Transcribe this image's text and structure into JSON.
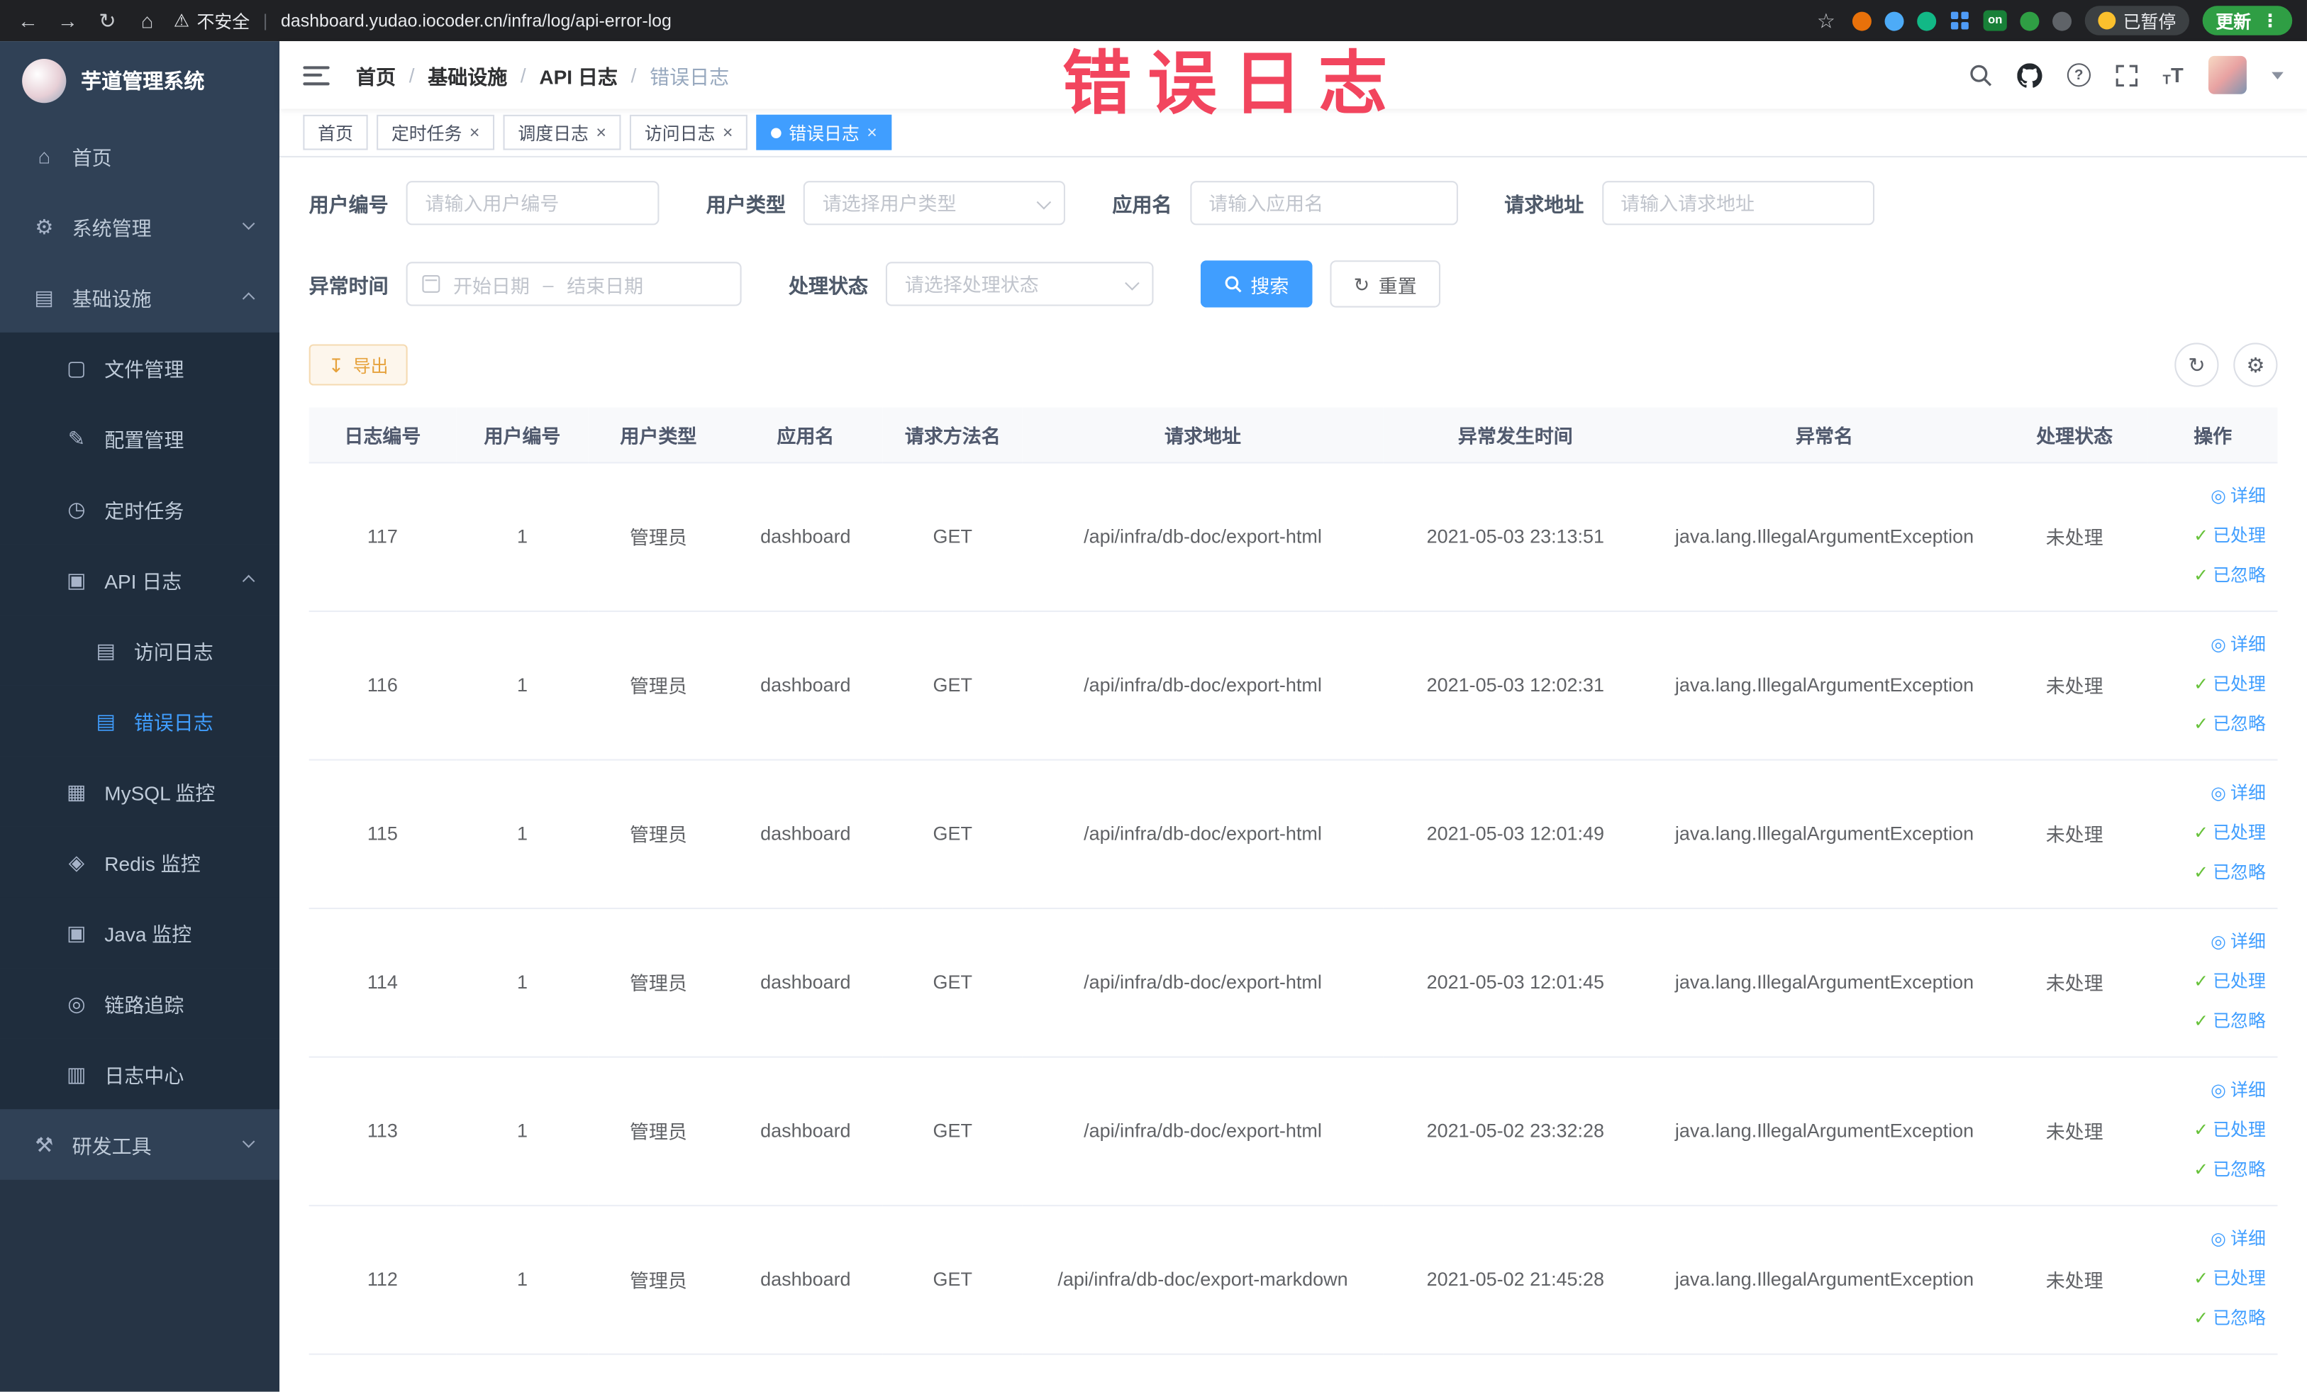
{
  "browser": {
    "security_warning": "不安全",
    "url": "dashboard.yudao.iocoder.cn/infra/log/api-error-log",
    "on_badge": "on",
    "paused_badge": "已暂停",
    "update_button": "更新"
  },
  "watermark": "错误日志",
  "sidebar": {
    "app_title": "芋道管理系统",
    "items": [
      {
        "label": "首页",
        "level": 1,
        "icon": "home-icon",
        "glyph": "⌂"
      },
      {
        "label": "系统管理",
        "level": 1,
        "icon": "gear-icon",
        "glyph": "⚙",
        "chevron": "down"
      },
      {
        "label": "基础设施",
        "level": 1,
        "icon": "infra-grid-icon",
        "glyph": "▤",
        "chevron": "up"
      },
      {
        "label": "文件管理",
        "level": 2,
        "icon": "file-icon",
        "glyph": "▢"
      },
      {
        "label": "配置管理",
        "level": 2,
        "icon": "config-edit-icon",
        "glyph": "✎"
      },
      {
        "label": "定时任务",
        "level": 2,
        "icon": "timer-icon",
        "glyph": "◷"
      },
      {
        "label": "API 日志",
        "level": 2,
        "icon": "api-log-icon",
        "glyph": "▣",
        "chevron": "up"
      },
      {
        "label": "访问日志",
        "level": 3,
        "icon": "access-log-icon",
        "glyph": "▤"
      },
      {
        "label": "错误日志",
        "level": 3,
        "icon": "error-log-icon",
        "glyph": "▤",
        "active": true
      },
      {
        "label": "MySQL 监控",
        "level": 2,
        "icon": "mysql-monitor-icon",
        "glyph": "▦"
      },
      {
        "label": "Redis 监控",
        "level": 2,
        "icon": "redis-monitor-icon",
        "glyph": "◈"
      },
      {
        "label": "Java 监控",
        "level": 2,
        "icon": "java-monitor-icon",
        "glyph": "▣"
      },
      {
        "label": "链路追踪",
        "level": 2,
        "icon": "trace-icon",
        "glyph": "◎"
      },
      {
        "label": "日志中心",
        "level": 2,
        "icon": "log-center-icon",
        "glyph": "▥"
      },
      {
        "label": "研发工具",
        "level": 1,
        "icon": "dev-tools-icon",
        "glyph": "⚒",
        "chevron": "down"
      }
    ]
  },
  "header": {
    "breadcrumb": [
      "首页",
      "基础设施",
      "API 日志",
      "错误日志"
    ]
  },
  "tags": [
    {
      "label": "首页",
      "closable": false,
      "active": false
    },
    {
      "label": "定时任务",
      "closable": true,
      "active": false
    },
    {
      "label": "调度日志",
      "closable": true,
      "active": false
    },
    {
      "label": "访问日志",
      "closable": true,
      "active": false
    },
    {
      "label": "错误日志",
      "closable": true,
      "active": true
    }
  ],
  "filters": {
    "user_id": {
      "label": "用户编号",
      "placeholder": "请输入用户编号"
    },
    "user_type": {
      "label": "用户类型",
      "placeholder": "请选择用户类型"
    },
    "app_name": {
      "label": "应用名",
      "placeholder": "请输入应用名"
    },
    "request_url": {
      "label": "请求地址",
      "placeholder": "请输入请求地址"
    },
    "exception_time": {
      "label": "异常时间",
      "start_placeholder": "开始日期",
      "separator": "–",
      "end_placeholder": "结束日期"
    },
    "process_status": {
      "label": "处理状态",
      "placeholder": "请选择处理状态"
    },
    "search_button": "搜索",
    "reset_button": "重置"
  },
  "toolbar": {
    "export_button": "导出"
  },
  "table": {
    "columns": [
      "日志编号",
      "用户编号",
      "用户类型",
      "应用名",
      "请求方法名",
      "请求地址",
      "异常发生时间",
      "异常名",
      "处理状态",
      "操作"
    ],
    "actions": [
      "详细",
      "已处理",
      "已忽略"
    ],
    "rows": [
      [
        "117",
        "1",
        "管理员",
        "dashboard",
        "GET",
        "/api/infra/db-doc/export-html",
        "2021-05-03 23:13:51",
        "java.lang.IllegalArgumentException",
        "未处理"
      ],
      [
        "116",
        "1",
        "管理员",
        "dashboard",
        "GET",
        "/api/infra/db-doc/export-html",
        "2021-05-03 12:02:31",
        "java.lang.IllegalArgumentException",
        "未处理"
      ],
      [
        "115",
        "1",
        "管理员",
        "dashboard",
        "GET",
        "/api/infra/db-doc/export-html",
        "2021-05-03 12:01:49",
        "java.lang.IllegalArgumentException",
        "未处理"
      ],
      [
        "114",
        "1",
        "管理员",
        "dashboard",
        "GET",
        "/api/infra/db-doc/export-html",
        "2021-05-03 12:01:45",
        "java.lang.IllegalArgumentException",
        "未处理"
      ],
      [
        "113",
        "1",
        "管理员",
        "dashboard",
        "GET",
        "/api/infra/db-doc/export-html",
        "2021-05-02 23:32:28",
        "java.lang.IllegalArgumentException",
        "未处理"
      ],
      [
        "112",
        "1",
        "管理员",
        "dashboard",
        "GET",
        "/api/infra/db-doc/export-markdown",
        "2021-05-02 21:45:28",
        "java.lang.IllegalArgumentException",
        "未处理"
      ]
    ]
  },
  "colors": {
    "primary": "#409eff",
    "success": "#67c23a",
    "warning": "#e6a23c",
    "watermark_red": "#f2455e",
    "sidebar_bg": "#304156",
    "sidebar_sub_bg": "#1f2d3d"
  }
}
